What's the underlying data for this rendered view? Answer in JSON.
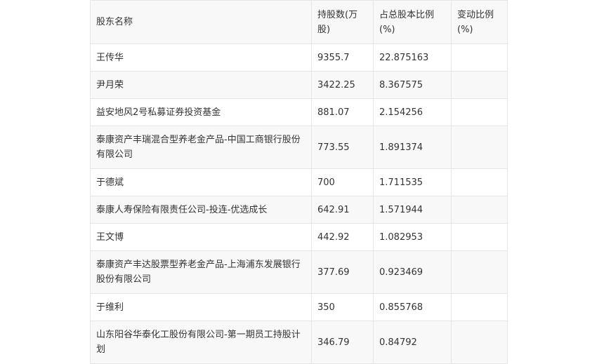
{
  "table": {
    "headers": [
      "股东名称",
      "持股数(万股)",
      "占总股本比例(%)",
      "变动比例(%)"
    ],
    "rows": [
      {
        "name": "王传华",
        "shares": "9355.7",
        "ratio": "22.875163",
        "change": ""
      },
      {
        "name": "尹月荣",
        "shares": "3422.25",
        "ratio": "8.367575",
        "change": ""
      },
      {
        "name": "益安地风2号私募证券投资基金",
        "shares": "881.07",
        "ratio": "2.154256",
        "change": ""
      },
      {
        "name": "泰康资产丰瑞混合型养老金产品-中国工商银行股份有限公司",
        "shares": "773.55",
        "ratio": "1.891374",
        "change": ""
      },
      {
        "name": "于德斌",
        "shares": "700",
        "ratio": "1.711535",
        "change": ""
      },
      {
        "name": "泰康人寿保险有限责任公司-投连-优选成长",
        "shares": "642.91",
        "ratio": "1.571944",
        "change": ""
      },
      {
        "name": "王文博",
        "shares": "442.92",
        "ratio": "1.082953",
        "change": ""
      },
      {
        "name": "泰康资产丰达股票型养老金产品-上海浦东发展银行股份有限公司",
        "shares": "377.69",
        "ratio": "0.923469",
        "change": ""
      },
      {
        "name": "于维利",
        "shares": "350",
        "ratio": "0.855768",
        "change": ""
      },
      {
        "name": "山东阳谷华泰化工股份有限公司-第一期员工持股计划",
        "shares": "346.79",
        "ratio": "0.84792",
        "change": ""
      }
    ]
  }
}
